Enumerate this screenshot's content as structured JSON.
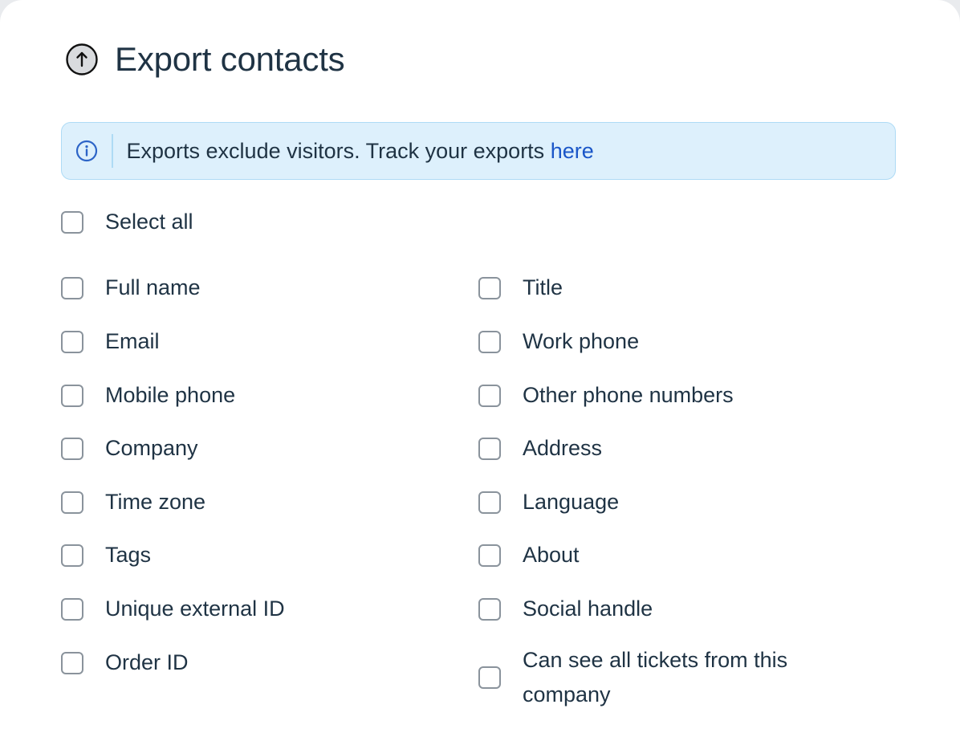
{
  "dialog": {
    "title": "Export contacts",
    "title_icon": "upload-circle-icon"
  },
  "notice": {
    "icon": "info-icon",
    "text": "Exports exclude visitors. Track your exports ",
    "link_text": "here"
  },
  "select_all": {
    "label": "Select all",
    "checked": false
  },
  "fields": {
    "left": [
      {
        "label": "Full name",
        "checked": false
      },
      {
        "label": "Email",
        "checked": false
      },
      {
        "label": "Mobile phone",
        "checked": false
      },
      {
        "label": "Company",
        "checked": false
      },
      {
        "label": "Time zone",
        "checked": false
      },
      {
        "label": "Tags",
        "checked": false
      },
      {
        "label": "Unique external ID",
        "checked": false
      },
      {
        "label": "Order ID",
        "checked": false
      }
    ],
    "right": [
      {
        "label": "Title",
        "checked": false
      },
      {
        "label": "Work phone",
        "checked": false
      },
      {
        "label": "Other phone numbers",
        "checked": false
      },
      {
        "label": "Address",
        "checked": false
      },
      {
        "label": "Language",
        "checked": false
      },
      {
        "label": "About",
        "checked": false
      },
      {
        "label": "Social handle",
        "checked": false
      },
      {
        "label": "Can see all tickets from this company",
        "checked": false
      }
    ]
  },
  "colors": {
    "title_text": "#1f3344",
    "notice_background": "#ddf0fc",
    "notice_border": "#aedbf5",
    "link": "#1a56c8",
    "info_icon": "#2c64c7",
    "checkbox_border": "#8a939c"
  }
}
